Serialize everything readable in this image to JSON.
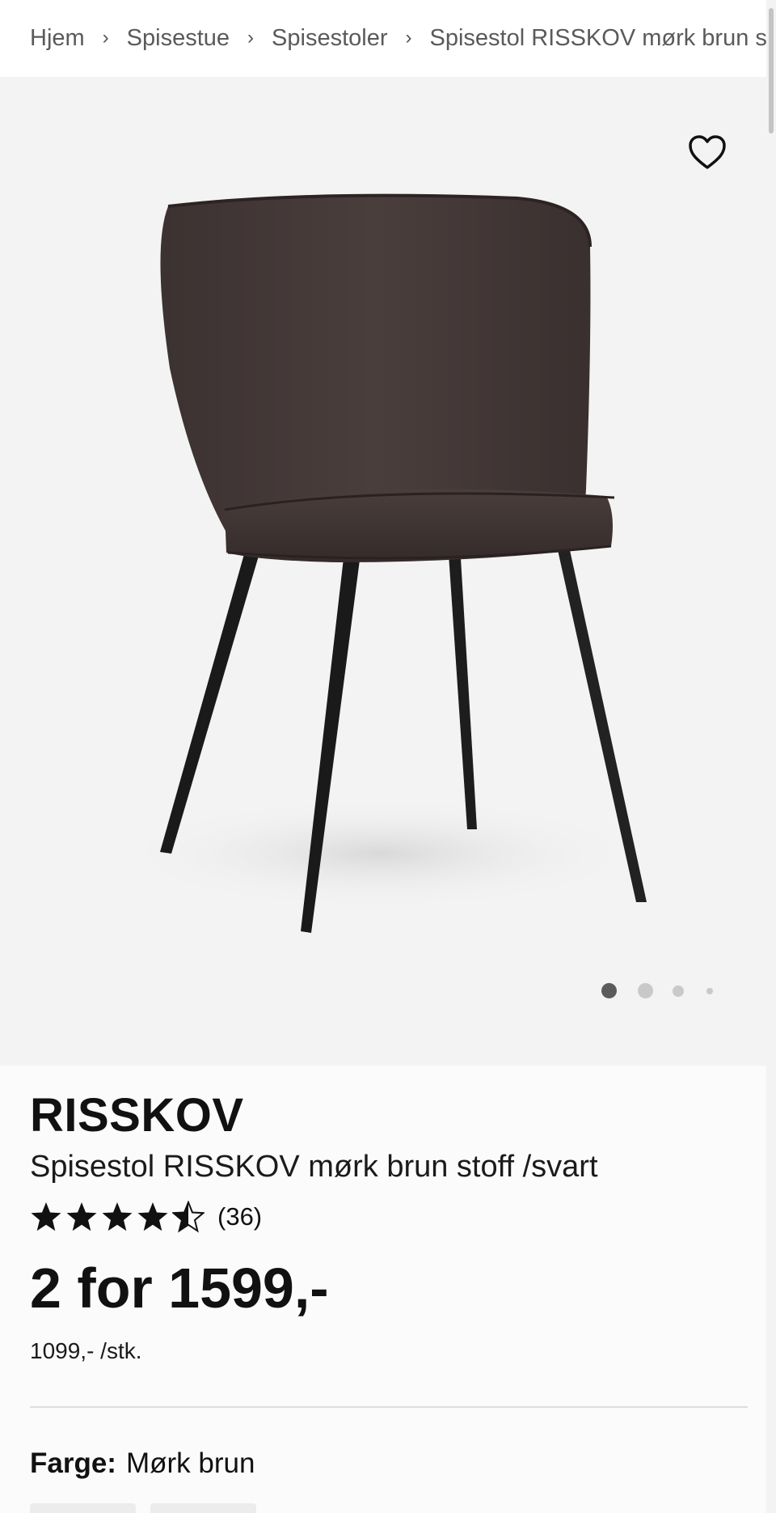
{
  "breadcrumb": {
    "items": [
      "Hjem",
      "Spisestue",
      "Spisestoler",
      "Spisestol RISSKOV mørk brun stoff /svart"
    ],
    "separator": "›"
  },
  "gallery": {
    "favorite_icon": "heart-outline-icon",
    "dots": [
      {
        "active": true
      },
      {
        "active": false
      },
      {
        "active": false
      },
      {
        "active": false
      }
    ]
  },
  "product": {
    "brand": "RISSKOV",
    "name": "Spisestol RISSKOV mørk brun stoff /svart",
    "rating": {
      "value": 4.5,
      "max": 5,
      "count_label": "(36)"
    },
    "price": "2 for 1599,-",
    "unit_price": "1099,- /stk.",
    "color": {
      "label": "Farge:",
      "value": "Mørk brun"
    }
  },
  "colors": {
    "accent": "#111111",
    "background": "#f3f3f3",
    "chair_fabric": "#443837",
    "legs": "#1e1e1e"
  }
}
